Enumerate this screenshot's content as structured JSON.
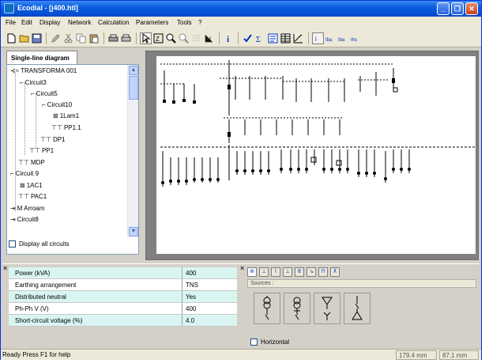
{
  "window": {
    "title": "Ecodial - [j400.htl]",
    "buttons": {
      "minimize": "_",
      "maximize": "❐",
      "close": "✕"
    }
  },
  "menu": [
    "File",
    "Edit",
    "Display",
    "Network",
    "Calculation",
    "Parameters",
    "Tools",
    "?"
  ],
  "left_panel": {
    "tab": "Single-line diagram",
    "tree": [
      "TRANSFORMA 001",
      "Circuit3",
      "Circuit5",
      "Circuit10",
      "1Lam1",
      "PP1.1",
      "DP1",
      "PP1",
      "MDP",
      "Circuit 9",
      "1AC1",
      "PAC1",
      "M Arroam",
      "Circuit8"
    ],
    "display_all": "Display all circuits",
    "scroll_up": "▲",
    "scroll_down": "▼"
  },
  "properties": [
    {
      "label": "Power (kVA)",
      "value": "400"
    },
    {
      "label": "Earthing arrangement",
      "value": "TNS"
    },
    {
      "label": "Distributed neutral",
      "value": "Yes"
    },
    {
      "label": "Ph-Ph V (V)",
      "value": "400"
    },
    {
      "label": "Short-circuit voltage (%)",
      "value": "4.0"
    }
  ],
  "panel_close": "×",
  "sources": {
    "label": "Sources :",
    "horizontal": "Horizontal"
  },
  "status": {
    "left": "Ready    Press F1 for help",
    "coord1": "179.4 mm",
    "coord2": "87.1 mm"
  },
  "colors": {
    "title_bar": "#0a5ddf",
    "row_highlight": "#d9f5f2",
    "toolbar_blue": "#0033cc"
  }
}
